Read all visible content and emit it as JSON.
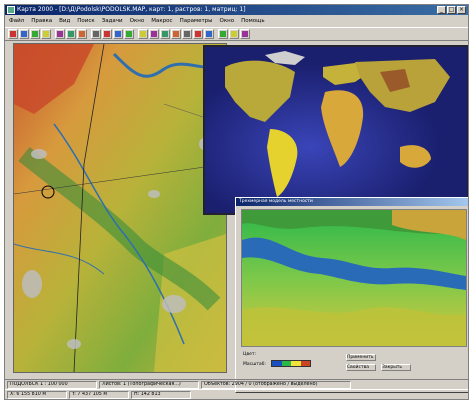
{
  "window": {
    "title": "Карта 2000 - [D:\\Д\\Podolsk\\PODOLSK.MAP, карт: 1, растров: 1, матриц: 1]"
  },
  "menu": [
    "Файл",
    "Правка",
    "Вид",
    "Поиск",
    "Задачи",
    "Окно",
    "Макрос",
    "Параметры",
    "Окно",
    "Помощь"
  ],
  "toolbar": {
    "icons": [
      "new-icon",
      "open-icon",
      "save-icon",
      "print-icon",
      "cut-icon",
      "copy-icon",
      "paste-icon",
      "pointer-icon",
      "move-icon",
      "select-icon",
      "draw-icon",
      "zoom-in-icon",
      "zoom-out-icon",
      "zoom-fit-icon",
      "hand-icon",
      "ruler-icon",
      "layers-icon",
      "legend-icon",
      "help-icon",
      "info-icon",
      "about-icon"
    ]
  },
  "right_toolbar": {
    "icons": [
      "tool-a-icon",
      "tool-b-icon",
      "tool-c-icon",
      "tool-d-icon",
      "tool-e-icon",
      "tool-f-icon",
      "tool-g-icon",
      "tool-h-icon",
      "tool-i-icon",
      "tool-j-icon",
      "tool-k-icon",
      "tool-l-icon"
    ]
  },
  "relief_window": {
    "title": "Трехмерная модель местности",
    "legend_colors": [
      "#1a4fbf",
      "#2bb84a",
      "#f2e33a",
      "#cc4422"
    ],
    "buttons": [
      "Применить",
      "Свойства",
      "Закрыть"
    ],
    "labels": [
      "Цвет:",
      "Масштаб:"
    ]
  },
  "status": {
    "scale": "ПОДОЛЬСК  1 : 100 000",
    "sheets": "Листов: 1 (Топографическая...)",
    "objects": "Объектов: 2904 / 0 (отображено / выделено)",
    "coord_x": "X: 6 155 810 м",
    "coord_y": "Y: 7 437 105 м",
    "height": "H: 142 813"
  },
  "colors": {
    "ocean": "#1a1f6e",
    "terrain_low": "#3f9a3a",
    "terrain_mid": "#c7b83a",
    "terrain_high": "#c9572e",
    "river": "#2e6fb0"
  }
}
